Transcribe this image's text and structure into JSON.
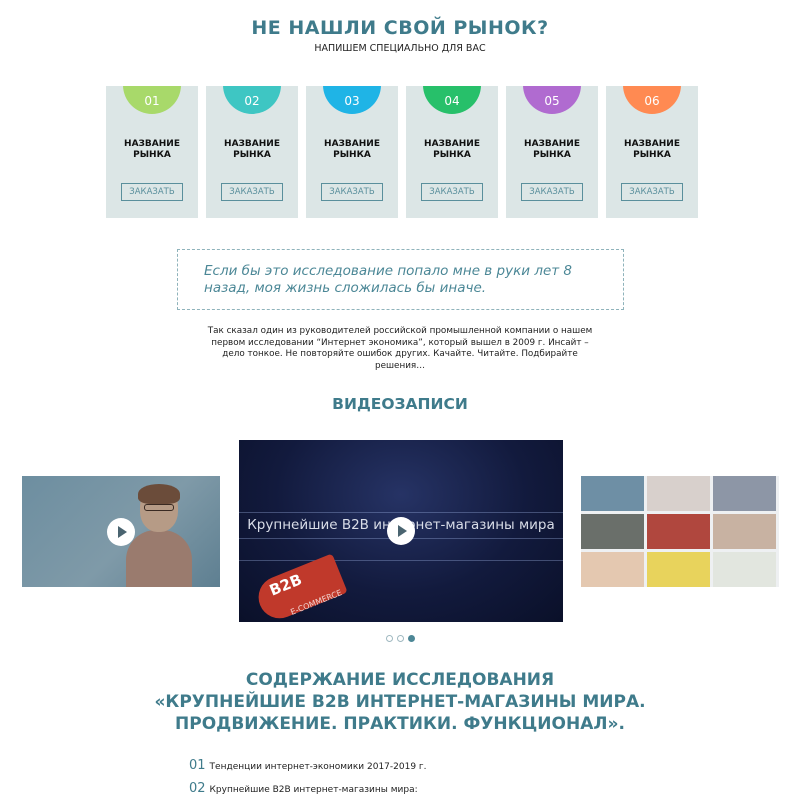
{
  "market_section": {
    "title": "НЕ НАШЛИ СВОЙ РЫНОК?",
    "subtitle": "НАПИШЕМ СПЕЦИАЛЬНО ДЛЯ ВАС",
    "cards": [
      {
        "number": "01",
        "title_line1": "НАЗВАНИЕ",
        "title_line2": "РЫНКА",
        "button": "ЗАКАЗАТЬ",
        "color": "#a8d96a"
      },
      {
        "number": "02",
        "title_line1": "НАЗВАНИЕ",
        "title_line2": "РЫНКА",
        "button": "ЗАКАЗАТЬ",
        "color": "#3ec6c3"
      },
      {
        "number": "03",
        "title_line1": "НАЗВАНИЕ",
        "title_line2": "РЫНКА",
        "button": "ЗАКАЗАТЬ",
        "color": "#1fb4e6"
      },
      {
        "number": "04",
        "title_line1": "НАЗВАНИЕ",
        "title_line2": "РЫНКА",
        "button": "ЗАКАЗАТЬ",
        "color": "#27c06a"
      },
      {
        "number": "05",
        "title_line1": "НАЗВАНИЕ",
        "title_line2": "РЫНКА",
        "button": "ЗАКАЗАТЬ",
        "color": "#b06bd0"
      },
      {
        "number": "06",
        "title_line1": "НАЗВАНИЕ",
        "title_line2": "РЫНКА",
        "button": "ЗАКАЗАТЬ",
        "color": "#ff8a52"
      }
    ]
  },
  "quote": {
    "text": "Если бы это исследование попало мне в руки лет 8 назад, моя жизнь сложилась бы иначе.",
    "description": "Так сказал один из руководителей российской промышленной компании о нашем первом исследовании “Интернет экономика”, который вышел в 2009 г. Инсайт – дело тонкое. Не повторяйте ошибок других. Качайте. Читайте. Подбирайте решения…"
  },
  "video_section": {
    "title": "ВИДЕОЗАПИСИ",
    "main_video_title": "Крупнейшие B2B интернет-магазины мира",
    "main_video_badge": "B2B",
    "main_video_badge_sub": "E-COMMERCE",
    "carousel_active_index": 2
  },
  "content_section": {
    "title_line1": "СОДЕРЖАНИЕ ИССЛЕДОВАНИЯ",
    "title_line2": "«КРУПНЕЙШИЕ B2B ИНТЕРНЕТ-МАГАЗИНЫ МИРА.",
    "title_line3": "ПРОДВИЖЕНИЕ. ПРАКТИКИ. ФУНКЦИОНАЛ».",
    "items": [
      {
        "number": "01",
        "text": "Тенденции интернет-экономики 2017-2019 г."
      },
      {
        "number": "02",
        "text": "Крупнейшие B2B интернет-магазины мира:"
      }
    ]
  },
  "colors": {
    "accent": "#3f7b8b",
    "card_bg": "#dce6e6"
  }
}
